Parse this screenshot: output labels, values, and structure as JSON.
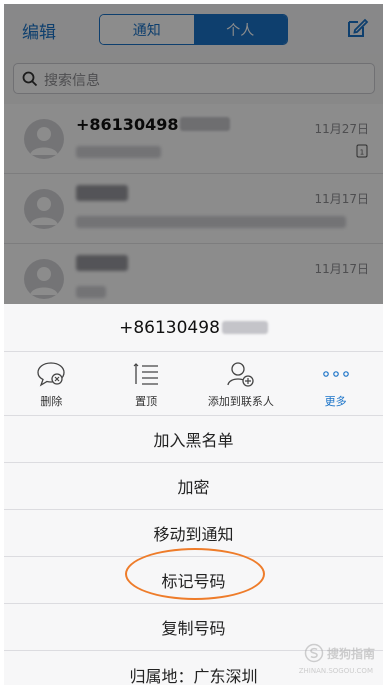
{
  "nav": {
    "edit_label": "编辑",
    "tabs": [
      {
        "label": "通知",
        "selected": false
      },
      {
        "label": "个人",
        "selected": true
      }
    ]
  },
  "search": {
    "placeholder": "搜索信息"
  },
  "conversations": [
    {
      "name": "+86130498",
      "date": "11月27日"
    },
    {
      "name": "",
      "date": "11月17日"
    },
    {
      "name": "",
      "date": "11月17日"
    }
  ],
  "sheet": {
    "title": "+86130498",
    "actions": [
      {
        "label": "删除",
        "icon": "delete-bubble-icon"
      },
      {
        "label": "置顶",
        "icon": "pin-top-icon"
      },
      {
        "label": "添加到联系人",
        "icon": "add-contact-icon"
      },
      {
        "label": "更多",
        "icon": "more-dots-icon"
      }
    ],
    "options": [
      "加入黑名单",
      "加密",
      "移动到通知",
      "标记号码",
      "复制号码",
      "归属地：广东深圳"
    ]
  },
  "watermark": {
    "text": "搜狗指南",
    "sub": "ZHINAN.SOGOU.COM"
  },
  "colors": {
    "accent": "#1a73c8",
    "highlight_circle": "#ee7c2a"
  }
}
